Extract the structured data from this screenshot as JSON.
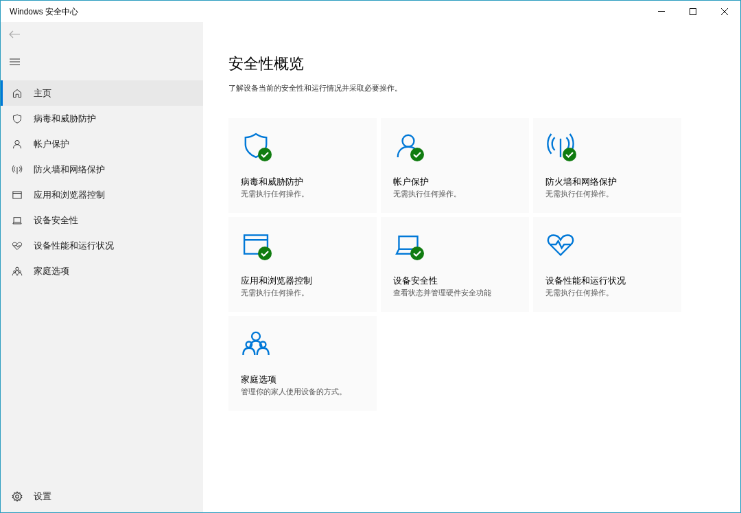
{
  "window": {
    "title": "Windows 安全中心"
  },
  "sidebar": {
    "items": [
      {
        "kind": "home",
        "label": "主页",
        "selected": true
      },
      {
        "kind": "shield",
        "label": "病毒和威胁防护",
        "selected": false
      },
      {
        "kind": "person",
        "label": "帐户保护",
        "selected": false
      },
      {
        "kind": "antenna",
        "label": "防火墙和网络保护",
        "selected": false
      },
      {
        "kind": "browser",
        "label": "应用和浏览器控制",
        "selected": false
      },
      {
        "kind": "laptop",
        "label": "设备安全性",
        "selected": false
      },
      {
        "kind": "heart",
        "label": "设备性能和运行状况",
        "selected": false
      },
      {
        "kind": "family",
        "label": "家庭选项",
        "selected": false
      }
    ],
    "settings": {
      "label": "设置"
    }
  },
  "main": {
    "title": "安全性概览",
    "subtitle": "了解设备当前的安全性和运行情况并采取必要操作。",
    "cards": [
      {
        "kind": "shield",
        "title": "病毒和威胁防护",
        "status": "无需执行任何操作。",
        "ok": true
      },
      {
        "kind": "person",
        "title": "帐户保护",
        "status": "无需执行任何操作。",
        "ok": true
      },
      {
        "kind": "antenna",
        "title": "防火墙和网络保护",
        "status": "无需执行任何操作。",
        "ok": true
      },
      {
        "kind": "browser",
        "title": "应用和浏览器控制",
        "status": "无需执行任何操作。",
        "ok": true
      },
      {
        "kind": "laptop",
        "title": "设备安全性",
        "status": "查看状态并管理硬件安全功能",
        "ok": true
      },
      {
        "kind": "heart",
        "title": "设备性能和运行状况",
        "status": "无需执行任何操作。",
        "ok": false
      },
      {
        "kind": "family",
        "title": "家庭选项",
        "status": "管理你的家人使用设备的方式。",
        "ok": false
      }
    ]
  }
}
